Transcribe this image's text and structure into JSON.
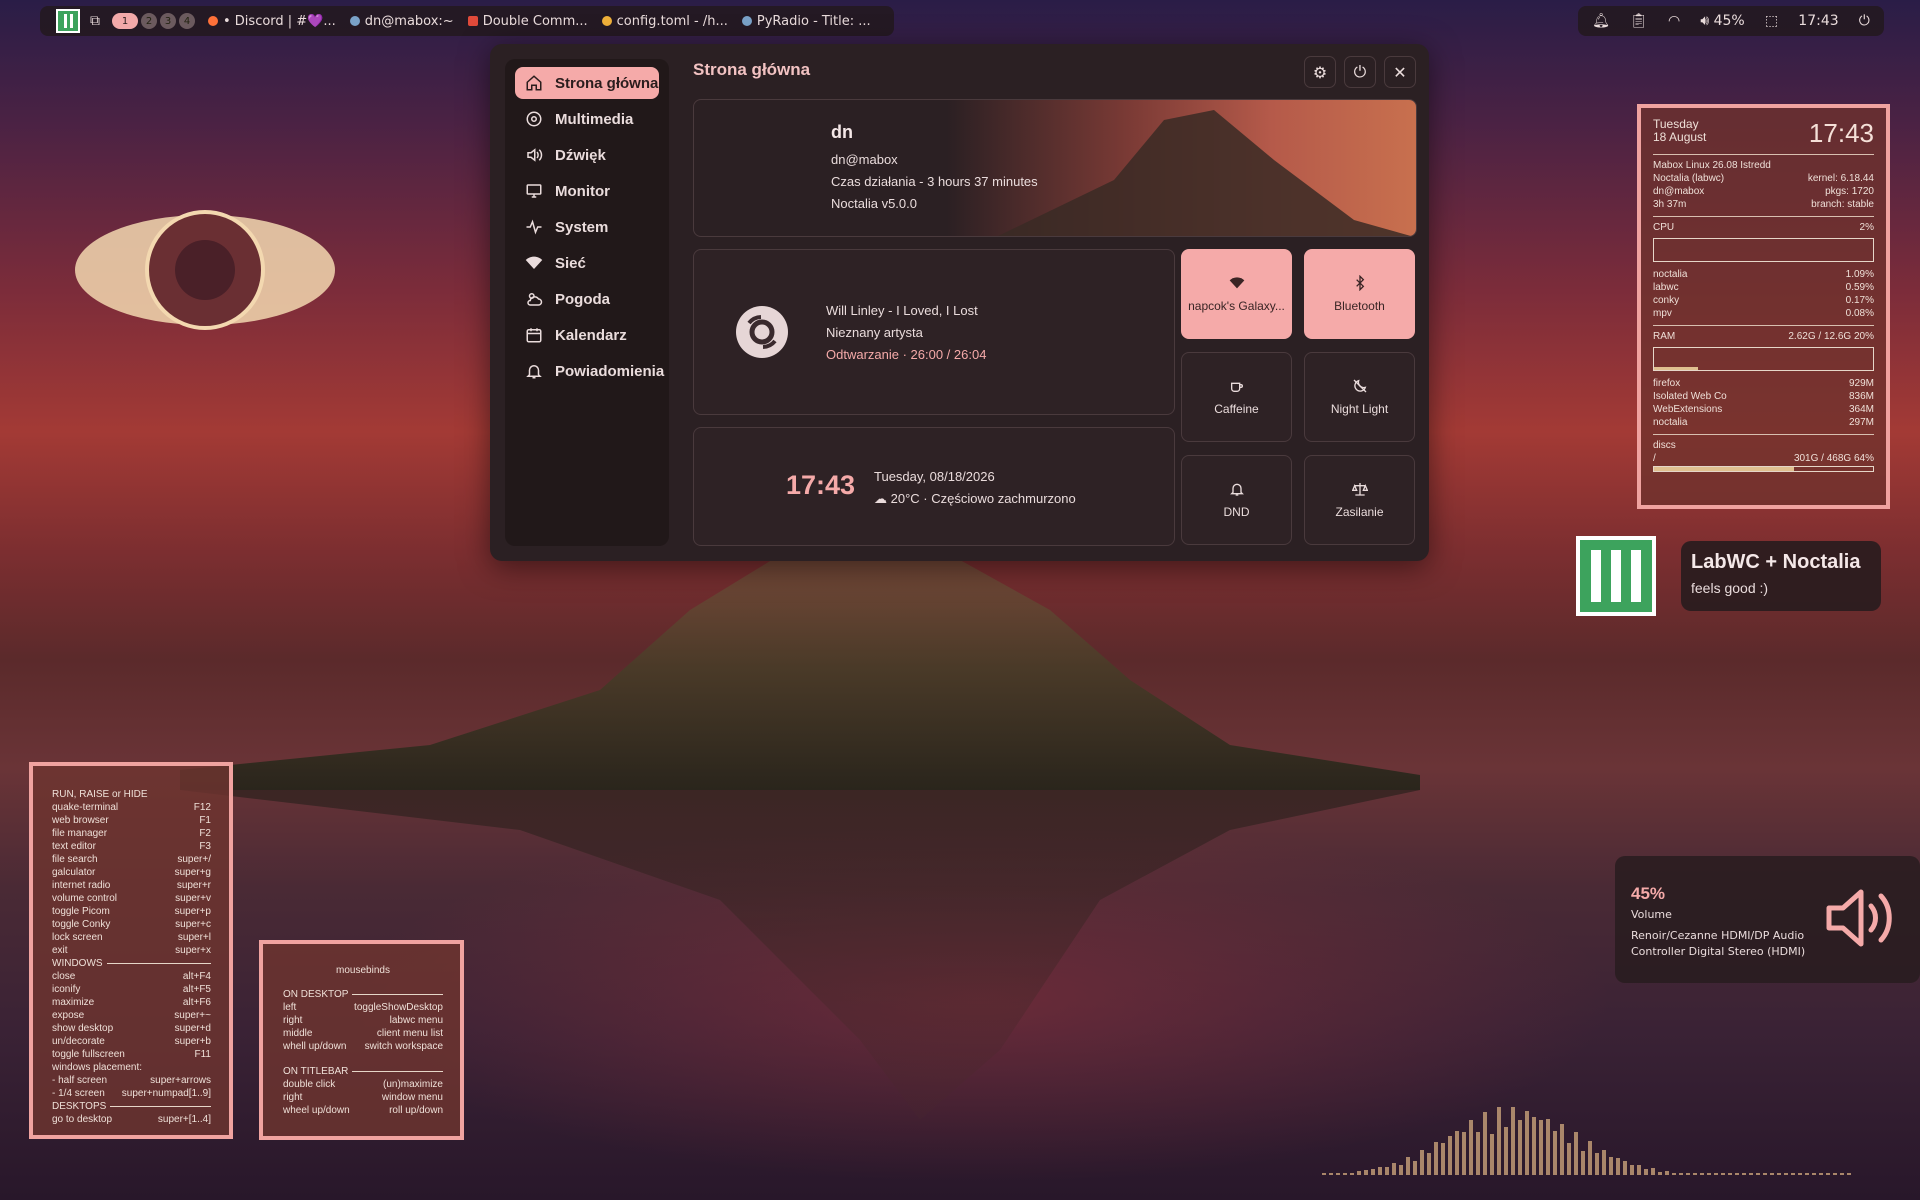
{
  "topbar": {
    "workspaces": [
      "1",
      "2",
      "3",
      "4"
    ],
    "tasks": [
      {
        "label": "• Discord | #💜...",
        "icon": "firefox-icon",
        "color": "#ff7139"
      },
      {
        "label": "dn@mabox:~",
        "icon": "terminal-icon",
        "color": "#7aa2c8"
      },
      {
        "label": "Double Comm...",
        "icon": "double-commander-icon",
        "color": "#e04a3a"
      },
      {
        "label": "config.toml - /h...",
        "icon": "editor-icon",
        "color": "#f0b13a"
      },
      {
        "label": "PyRadio - Title: ...",
        "icon": "radio-icon",
        "color": "#7aa2c8"
      }
    ],
    "volume": "45%",
    "clock": "17:43"
  },
  "panel": {
    "title": "Strona główna",
    "nav": [
      {
        "label": "Strona główna",
        "icon": "home-icon"
      },
      {
        "label": "Multimedia",
        "icon": "disc-icon"
      },
      {
        "label": "Dźwięk",
        "icon": "speaker-icon"
      },
      {
        "label": "Monitor",
        "icon": "monitor-icon"
      },
      {
        "label": "System",
        "icon": "pulse-icon"
      },
      {
        "label": "Sieć",
        "icon": "wifi-icon"
      },
      {
        "label": "Pogoda",
        "icon": "weather-icon"
      },
      {
        "label": "Kalendarz",
        "icon": "calendar-icon"
      },
      {
        "label": "Powiadomienia",
        "icon": "bell-icon"
      }
    ],
    "profile": {
      "name": "dn",
      "host": "dn@mabox",
      "uptime": "Czas działania - 3 hours 37 minutes",
      "version": "Noctalia v5.0.0"
    },
    "media": {
      "title": "Will Linley - I Loved, I Lost",
      "artist": "Nieznany artysta",
      "status": "Odtwarzanie · 26:00 / 26:04"
    },
    "clock": {
      "time": "17:43",
      "date": "Tuesday, 08/18/2026",
      "weather": "20°C · Częściowo zachmurzono"
    },
    "tiles": [
      {
        "label": "napcok's Galaxy...",
        "icon": "wifi-icon",
        "on": true
      },
      {
        "label": "Bluetooth",
        "icon": "bluetooth-icon",
        "on": true
      },
      {
        "label": "Caffeine",
        "icon": "coffee-icon",
        "on": false
      },
      {
        "label": "Night Light",
        "icon": "night-light-icon",
        "on": false
      },
      {
        "label": "DND",
        "icon": "bell-icon",
        "on": false
      },
      {
        "label": "Zasilanie",
        "icon": "scale-icon",
        "on": false
      }
    ]
  },
  "conky": {
    "day": "Tuesday",
    "date": "18 August",
    "time": "17:43",
    "info": [
      [
        "Mabox Linux 26.08 Istredd",
        ""
      ],
      [
        "Noctalia (labwc)",
        "kernel: 6.18.44"
      ],
      [
        "dn@mabox",
        "pkgs: 1720"
      ],
      [
        "3h 37m",
        "branch: stable"
      ]
    ],
    "cpu_label": "CPU",
    "cpu_val": "2%",
    "cpu_fraction": 0.02,
    "procs": [
      [
        "noctalia",
        "1.09%"
      ],
      [
        "labwc",
        "0.59%"
      ],
      [
        "conky",
        "0.17%"
      ],
      [
        "mpv",
        "0.08%"
      ]
    ],
    "ram_label": "RAM",
    "ram_val": "2.62G / 12.6G 20%",
    "ram_fraction": 0.2,
    "mem": [
      [
        "firefox",
        "929M"
      ],
      [
        "Isolated Web Co",
        "836M"
      ],
      [
        "WebExtensions",
        "364M"
      ],
      [
        "noctalia",
        "297M"
      ]
    ],
    "discs_label": "discs",
    "disc_mount": "/",
    "disc_val": "301G / 468G 64%",
    "disc_fraction": 0.64
  },
  "keybinds": {
    "head": "RUN, RAISE or HIDE",
    "rows1": [
      [
        "quake-terminal",
        "F12"
      ],
      [
        "web browser",
        "F1"
      ],
      [
        "file manager",
        "F2"
      ],
      [
        "text editor",
        "F3"
      ],
      [
        "file search",
        "super+/"
      ],
      [
        "galculator",
        "super+g"
      ],
      [
        "internet radio",
        "super+r"
      ],
      [
        "volume control",
        "super+v"
      ],
      [
        "toggle Picom",
        "super+p"
      ],
      [
        "toggle Conky",
        "super+c"
      ],
      [
        "lock screen",
        "super+l"
      ],
      [
        "exit",
        "super+x"
      ]
    ],
    "windows": "WINDOWS",
    "rows2": [
      [
        "close",
        "alt+F4"
      ],
      [
        "iconify",
        "alt+F5"
      ],
      [
        "maximize",
        "alt+F6"
      ],
      [
        "expose",
        "super+~"
      ],
      [
        "show desktop",
        "super+d"
      ],
      [
        "un/decorate",
        "super+b"
      ],
      [
        "toggle fullscreen",
        "F11"
      ]
    ],
    "placement": "windows placement:",
    "rows3": [
      [
        " - half screen",
        "super+arrows"
      ],
      [
        " - 1/4 screen",
        "super+numpad[1..9]"
      ]
    ],
    "desktops": "DESKTOPS",
    "rows4": [
      [
        "go to desktop",
        "super+[1..4]"
      ]
    ]
  },
  "mousebinds": {
    "title": "mousebinds",
    "desk_head": "ON DESKTOP",
    "desk": [
      [
        "left",
        "toggleShowDesktop"
      ],
      [
        "right",
        "labwc menu"
      ],
      [
        "middle",
        "client menu list"
      ],
      [
        "whell up/down",
        "switch workspace"
      ]
    ],
    "title_head": "ON TITLEBAR",
    "tb": [
      [
        "double click",
        "(un)maximize"
      ],
      [
        "right",
        "window menu"
      ],
      [
        "wheel up/down",
        "roll up/down"
      ]
    ]
  },
  "volume_osd": {
    "percent": "45%",
    "label": "Volume",
    "device": "Renoir/Cezanne HDMI/DP Audio Controller Digital Stereo (HDMI)"
  },
  "labwc": {
    "title": "LabWC + Noctalia",
    "subtitle": "feels good :)"
  },
  "colors": {
    "accent": "#f5aaa9",
    "panel_bg": "#2b2023",
    "conky_border": "#f0a3a0",
    "logo_green": "#3da35d"
  }
}
